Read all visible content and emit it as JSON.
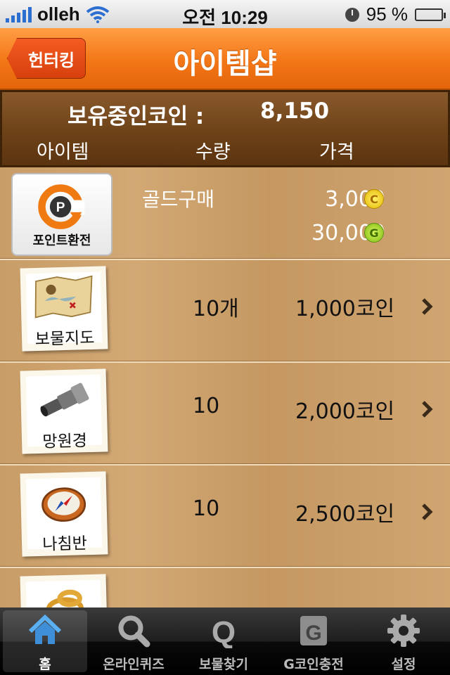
{
  "status_bar": {
    "carrier": "olleh",
    "time": "오전 10:29",
    "battery": "95 %",
    "battery_level": 0.95,
    "icons": [
      "signal-icon",
      "wifi-icon",
      "clock-icon",
      "battery-icon"
    ]
  },
  "nav": {
    "back_label": "헌터킹",
    "title": "아이템샵"
  },
  "coins": {
    "label": "보유중인코인 :",
    "value": "8,150"
  },
  "columns": {
    "item": "아이템",
    "quantity": "수량",
    "price": "가격"
  },
  "gold_purchase": {
    "button_label": "포인트환전",
    "label": "골드구매",
    "price_coin": "3,000",
    "price_gold": "30,000",
    "coin_icon": "C",
    "gold_icon": "G"
  },
  "items": [
    {
      "name": "보물지도",
      "quantity": "10개",
      "price": "1,000코인",
      "icon": "treasure-map-icon"
    },
    {
      "name": "망원경",
      "quantity": "10",
      "price": "2,000코인",
      "icon": "telescope-icon"
    },
    {
      "name": "나침반",
      "quantity": "10",
      "price": "2,500코인",
      "icon": "compass-icon"
    }
  ],
  "tabs": [
    {
      "label": "홈",
      "icon": "home-icon",
      "active": true
    },
    {
      "label": "온라인퀴즈",
      "icon": "search-icon"
    },
    {
      "label": "보물찾기",
      "icon": "q-icon"
    },
    {
      "label": "G코인충전",
      "icon": "g-coin-icon"
    },
    {
      "label": "설정",
      "icon": "gear-icon"
    }
  ],
  "colors": {
    "nav_orange": "#f37617",
    "header_brown": "#6b4016",
    "wood": "#cba06a",
    "status_blue": "#2d6fd1"
  }
}
